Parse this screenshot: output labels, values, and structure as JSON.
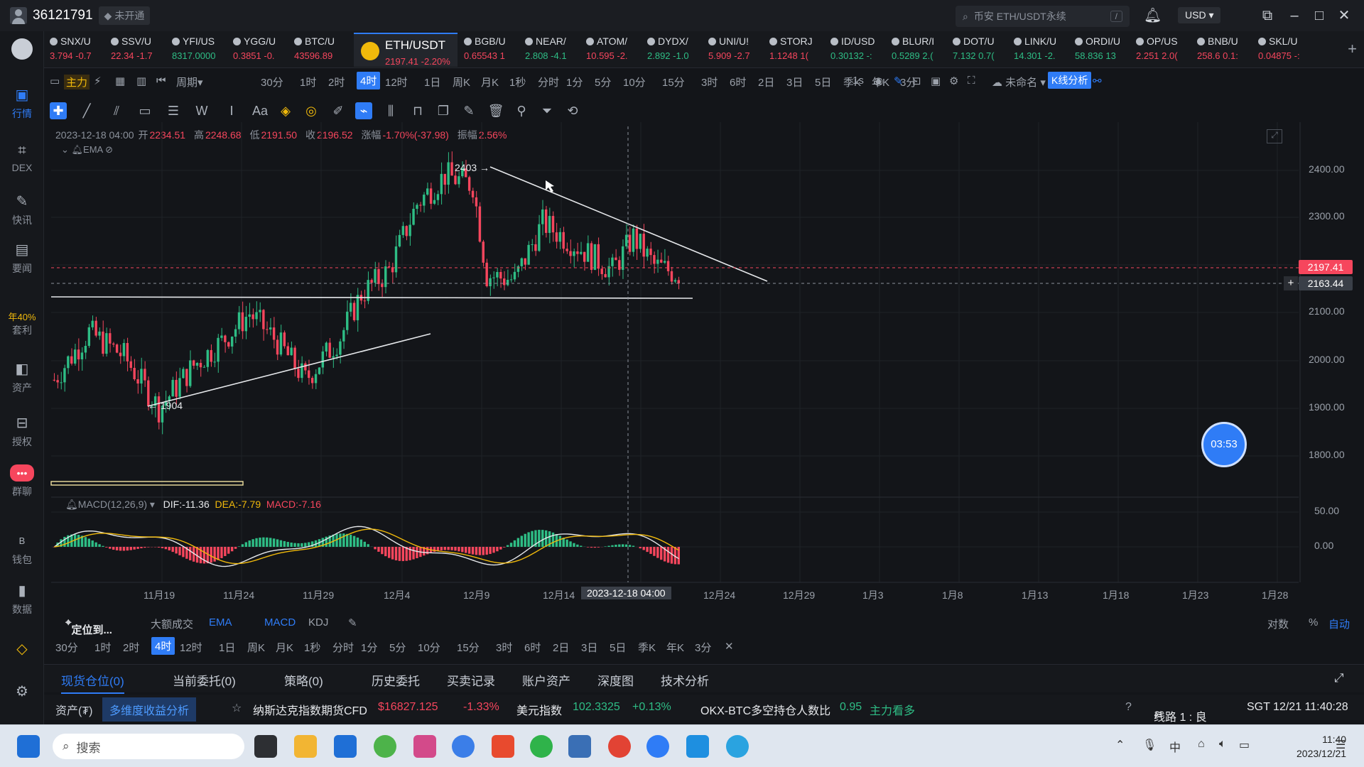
{
  "titlebar": {
    "uid": "36121791",
    "status": "未开通",
    "search_placeholder": "币安 ETH/USDT永续",
    "search_key": "/",
    "currency": "USD"
  },
  "sidebar": [
    {
      "label": "行情",
      "icon": "market-icon",
      "active": true
    },
    {
      "label": "DEX",
      "icon": "dex-icon"
    },
    {
      "label": "快讯",
      "icon": "news-icon"
    },
    {
      "label": "要闻",
      "icon": "headline-icon"
    },
    {
      "label": "套利",
      "icon": "arbitrage-icon",
      "rate": "年40%"
    },
    {
      "label": "资产",
      "icon": "assets-icon"
    },
    {
      "label": "授权",
      "icon": "auth-icon"
    },
    {
      "label": "群聊",
      "icon": "chat-icon"
    },
    {
      "label": "钱包",
      "icon": "wallet-icon"
    },
    {
      "label": "数据",
      "icon": "data-icon"
    }
  ],
  "tickers": [
    {
      "name": "SNX/U",
      "price": "3.794",
      "chg": "-0.7",
      "dir": "dn"
    },
    {
      "name": "SSV/U",
      "price": "22.34",
      "chg": "-1.7",
      "dir": "dn"
    },
    {
      "name": "YFI/US",
      "price": "8317.0000",
      "chg": "",
      "dir": "up"
    },
    {
      "name": "YGG/U",
      "price": "0.3851",
      "chg": "-0.",
      "dir": "dn"
    },
    {
      "name": "BTC/U",
      "price": "43596.89",
      "chg": "",
      "dir": "dn"
    },
    {
      "name": "ETH/USDT",
      "price": "2197.41",
      "chg": "-2.20%",
      "dir": "dn",
      "selected": true
    },
    {
      "name": "BGB/U",
      "price": "0.65543",
      "chg": "1",
      "dir": "dn"
    },
    {
      "name": "NEAR/",
      "price": "2.808",
      "chg": "-4.1",
      "dir": "up"
    },
    {
      "name": "ATOM/",
      "price": "10.595",
      "chg": "-2.",
      "dir": "dn"
    },
    {
      "name": "DYDX/",
      "price": "2.892",
      "chg": "-1.0",
      "dir": "up"
    },
    {
      "name": "UNI/U!",
      "price": "5.909",
      "chg": "-2.7",
      "dir": "dn"
    },
    {
      "name": "STORJ",
      "price": "1.1248",
      "chg": "1(",
      "dir": "dn"
    },
    {
      "name": "ID/USD",
      "price": "0.30132",
      "chg": "-:",
      "dir": "up"
    },
    {
      "name": "BLUR/I",
      "price": "0.5289",
      "chg": "2.(",
      "dir": "up"
    },
    {
      "name": "DOT/U",
      "price": "7.132",
      "chg": "0.7(",
      "dir": "up"
    },
    {
      "name": "LINK/U",
      "price": "14.301",
      "chg": "-2.",
      "dir": "up"
    },
    {
      "name": "ORDI/U",
      "price": "58.836",
      "chg": "13",
      "dir": "up"
    },
    {
      "name": "OP/US",
      "price": "2.251",
      "chg": "2.0(",
      "dir": "dn"
    },
    {
      "name": "BNB/U",
      "price": "258.6",
      "chg": "0.1:",
      "dir": "dn"
    },
    {
      "name": "SKL/U",
      "price": "0.04875",
      "chg": "-:",
      "dir": "dn"
    }
  ],
  "periods": [
    "30分",
    "1时",
    "2时",
    "4时",
    "12时",
    "1日",
    "周K",
    "月K",
    "1秒",
    "分时",
    "1分",
    "5分",
    "10分",
    "15分",
    "3时",
    "6时",
    "2日",
    "3日",
    "5日",
    "季K",
    "年K",
    "3分"
  ],
  "active_period": "4时",
  "toolbar": {
    "main": "主力",
    "cycle": "周期",
    "tick": "1s",
    "layout": "未命名",
    "kline": "K线分析"
  },
  "ohlc": {
    "time": "2023-12-18 04:00",
    "open_label": "开",
    "open": "2234.51",
    "high_label": "高",
    "high": "2248.68",
    "low_label": "低",
    "low": "2191.50",
    "close_label": "收",
    "close": "2196.52",
    "chg_label": "涨幅",
    "chg": "-1.70%(-37.98)",
    "amp_label": "振幅",
    "amp": "2.56%"
  },
  "ema_label": "EMA",
  "macd": {
    "label": "MACD(12,26,9)",
    "dif": "DIF:-11.36",
    "dea": "DEA:-7.79",
    "macd": "MACD:-7.16"
  },
  "annotations": {
    "high": "2403",
    "low": "1904"
  },
  "price_axis": [
    "2400.00",
    "2300.00",
    "2200.00",
    "2100.00",
    "2000.00",
    "1900.00",
    "1800.00"
  ],
  "macd_axis": [
    "50.00",
    "0.00"
  ],
  "last_price": "2197.41",
  "cross_price": "2163.44",
  "date_axis": [
    "11月19",
    "11月24",
    "11月29",
    "12月4",
    "12月9",
    "12月14",
    "12月24",
    "12月29",
    "1月3",
    "1月8",
    "1月13",
    "1月18",
    "1月23",
    "1月28"
  ],
  "cross_date": "2023-12-18 04:00",
  "timer": "03:53",
  "indicators": {
    "locate": "定位到...",
    "big": "大额成交",
    "ema": "EMA",
    "macd": "MACD",
    "kdj": "KDJ",
    "log": "对数",
    "pct": "%",
    "auto": "自动"
  },
  "periods2": [
    "30分",
    "1时",
    "2时",
    "4时",
    "12时",
    "1日",
    "周K",
    "月K",
    "1秒",
    "分时",
    "1分",
    "5分",
    "10分",
    "15分",
    "3时",
    "6时",
    "2日",
    "3日",
    "5日",
    "季K",
    "年K",
    "3分"
  ],
  "tabs": [
    "现货仓位(0)",
    "当前委托(0)",
    "策略(0)",
    "历史委托",
    "买卖记录",
    "账户资产",
    "深度图",
    "技术分析"
  ],
  "status": {
    "asset": "资产(₮)",
    "analysis": "多维度收益分析",
    "nasdaq": "纳斯达克指数期货CFD",
    "nasdaq_price": "$16827.125",
    "nasdaq_chg": "-1.33%",
    "dxy": "美元指数",
    "dxy_price": "102.3325",
    "dxy_chg": "+0.13%",
    "okx": "OKX-BTC多空持仓人数比",
    "okx_val": "0.95",
    "okx_view": "主力看多",
    "line": "线路 1 : 良",
    "time": "SGT 12/21 11:40:28"
  },
  "taskbar": {
    "search": "搜索",
    "time": "11:40",
    "date": "2023/12/21",
    "ime": "中"
  },
  "colors": {
    "accent": "#2f7cf6",
    "up": "#2ebd85",
    "down": "#f6465d",
    "bg": "#131519"
  }
}
